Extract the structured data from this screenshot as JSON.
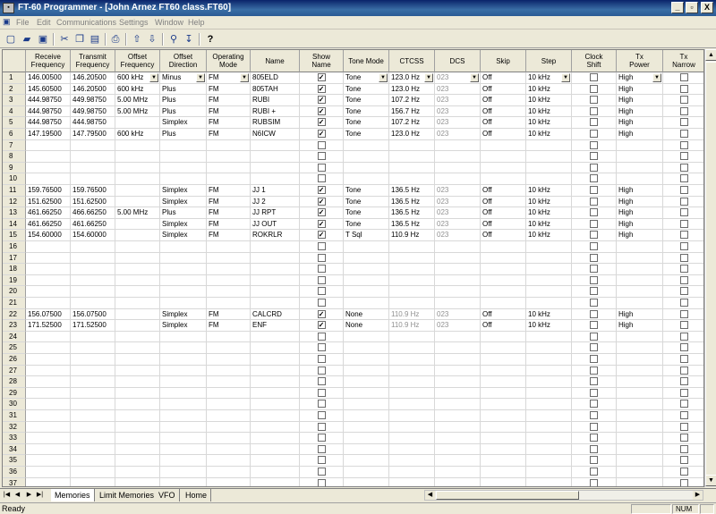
{
  "window": {
    "title": "FT-60 Programmer - [John Arnez FT60 class.FT60]",
    "min_label": "_",
    "max_label": "▫",
    "close_label": "X"
  },
  "menu": [
    "File",
    "Edit",
    "Communications",
    "Settings",
    "Window",
    "Help"
  ],
  "toolbar_icons": [
    "new-icon",
    "open-icon",
    "save-icon",
    "cut-icon",
    "copy-icon",
    "paste-icon",
    "print-icon",
    "move-up-icon",
    "move-down-icon",
    "find-icon",
    "sort-icon",
    "help-icon"
  ],
  "columns": [
    "",
    "Receive\nFrequency",
    "Transmit\nFrequency",
    "Offset\nFrequency",
    "Offset\nDirection",
    "Operating\nMode",
    "Name",
    "Show\nName",
    "Tone Mode",
    "CTCSS",
    "DCS",
    "Skip",
    "Step",
    "Clock\nShift",
    "Tx\nPower",
    "Tx\nNarrow"
  ],
  "rows": [
    {
      "n": "1",
      "rx": "146.00500",
      "tx": "146.20500",
      "off": "600 kHz",
      "dir": "Minus",
      "mode": "FM",
      "name": "805ELD",
      "show": true,
      "tone": "Tone",
      "ctcss": "123.0 Hz",
      "dcs": "023",
      "skip": "Off",
      "step": "10 kHz",
      "pwr": "High",
      "dd": true
    },
    {
      "n": "2",
      "rx": "145.60500",
      "tx": "146.20500",
      "off": "600 kHz",
      "dir": "Plus",
      "mode": "FM",
      "name": "805TAH",
      "show": true,
      "tone": "Tone",
      "ctcss": "123.0 Hz",
      "dcs": "023",
      "skip": "Off",
      "step": "10 kHz",
      "pwr": "High"
    },
    {
      "n": "3",
      "rx": "444.98750",
      "tx": "449.98750",
      "off": "5.00 MHz",
      "dir": "Plus",
      "mode": "FM",
      "name": "RUBI",
      "show": true,
      "tone": "Tone",
      "ctcss": "107.2 Hz",
      "dcs": "023",
      "skip": "Off",
      "step": "10 kHz",
      "pwr": "High"
    },
    {
      "n": "4",
      "rx": "444.98750",
      "tx": "449.98750",
      "off": "5.00 MHz",
      "dir": "Plus",
      "mode": "FM",
      "name": "RUBI +",
      "show": true,
      "tone": "Tone",
      "ctcss": "156.7 Hz",
      "dcs": "023",
      "skip": "Off",
      "step": "10 kHz",
      "pwr": "High"
    },
    {
      "n": "5",
      "rx": "444.98750",
      "tx": "444.98750",
      "off": "",
      "dir": "Simplex",
      "mode": "FM",
      "name": "RUBSIM",
      "show": true,
      "tone": "Tone",
      "ctcss": "107.2 Hz",
      "dcs": "023",
      "skip": "Off",
      "step": "10 kHz",
      "pwr": "High"
    },
    {
      "n": "6",
      "rx": "147.19500",
      "tx": "147.79500",
      "off": "600 kHz",
      "dir": "Plus",
      "mode": "FM",
      "name": "N6ICW",
      "show": true,
      "tone": "Tone",
      "ctcss": "123.0 Hz",
      "dcs": "023",
      "skip": "Off",
      "step": "10 kHz",
      "pwr": "High"
    },
    {
      "n": "7"
    },
    {
      "n": "8"
    },
    {
      "n": "9"
    },
    {
      "n": "10"
    },
    {
      "n": "11",
      "rx": "159.76500",
      "tx": "159.76500",
      "off": "",
      "dir": "Simplex",
      "mode": "FM",
      "name": "JJ 1",
      "show": true,
      "tone": "Tone",
      "ctcss": "136.5 Hz",
      "dcs": "023",
      "skip": "Off",
      "step": "10 kHz",
      "pwr": "High"
    },
    {
      "n": "12",
      "rx": "151.62500",
      "tx": "151.62500",
      "off": "",
      "dir": "Simplex",
      "mode": "FM",
      "name": "JJ 2",
      "show": true,
      "tone": "Tone",
      "ctcss": "136.5 Hz",
      "dcs": "023",
      "skip": "Off",
      "step": "10 kHz",
      "pwr": "High"
    },
    {
      "n": "13",
      "rx": "461.66250",
      "tx": "466.66250",
      "off": "5.00 MHz",
      "dir": "Plus",
      "mode": "FM",
      "name": "JJ RPT",
      "show": true,
      "tone": "Tone",
      "ctcss": "136.5 Hz",
      "dcs": "023",
      "skip": "Off",
      "step": "10 kHz",
      "pwr": "High"
    },
    {
      "n": "14",
      "rx": "461.66250",
      "tx": "461.66250",
      "off": "",
      "dir": "Simplex",
      "mode": "FM",
      "name": "JJ OUT",
      "show": true,
      "tone": "Tone",
      "ctcss": "136.5 Hz",
      "dcs": "023",
      "skip": "Off",
      "step": "10 kHz",
      "pwr": "High"
    },
    {
      "n": "15",
      "rx": "154.60000",
      "tx": "154.60000",
      "off": "",
      "dir": "Simplex",
      "mode": "FM",
      "name": "ROKRLR",
      "show": true,
      "tone": "T Sql",
      "ctcss": "110.9 Hz",
      "dcs": "023",
      "skip": "Off",
      "step": "10 kHz",
      "pwr": "High"
    },
    {
      "n": "16"
    },
    {
      "n": "17"
    },
    {
      "n": "18"
    },
    {
      "n": "19"
    },
    {
      "n": "20"
    },
    {
      "n": "21"
    },
    {
      "n": "22",
      "rx": "156.07500",
      "tx": "156.07500",
      "off": "",
      "dir": "Simplex",
      "mode": "FM",
      "name": "CALCRD",
      "show": true,
      "tone": "None",
      "ctcss": "110.9 Hz",
      "dcs": "023",
      "skip": "Off",
      "step": "10 kHz",
      "pwr": "High",
      "ctgray": true
    },
    {
      "n": "23",
      "rx": "171.52500",
      "tx": "171.52500",
      "off": "",
      "dir": "Simplex",
      "mode": "FM",
      "name": "ENF",
      "show": true,
      "tone": "None",
      "ctcss": "110.9 Hz",
      "dcs": "023",
      "skip": "Off",
      "step": "10 kHz",
      "pwr": "High",
      "ctgray": true
    },
    {
      "n": "24"
    },
    {
      "n": "25"
    },
    {
      "n": "26"
    },
    {
      "n": "27"
    },
    {
      "n": "28"
    },
    {
      "n": "29"
    },
    {
      "n": "30"
    },
    {
      "n": "31"
    },
    {
      "n": "32"
    },
    {
      "n": "33"
    },
    {
      "n": "34"
    },
    {
      "n": "35"
    },
    {
      "n": "36"
    },
    {
      "n": "37"
    }
  ],
  "tabs": [
    "Memories",
    "Limit Memories",
    "VFO",
    "Home"
  ],
  "status": {
    "text": "Ready",
    "num": "NUM"
  }
}
